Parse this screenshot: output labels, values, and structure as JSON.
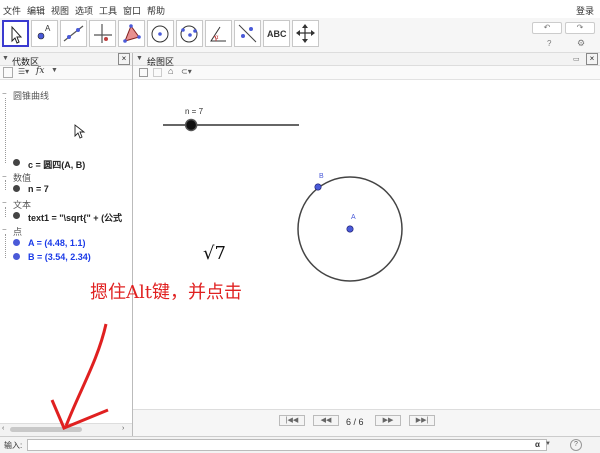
{
  "menu": {
    "items": [
      "文件",
      "编辑",
      "视图",
      "选项",
      "工具",
      "窗口",
      "帮助"
    ],
    "login": "登录"
  },
  "toolbar": {
    "text_tool_label": "ABC",
    "undo_label": "↶",
    "redo_label": "↷",
    "help_label": "?",
    "settings_label": "⚙"
  },
  "algebra": {
    "title": "代数区",
    "groups": [
      {
        "name": "圆锥曲线",
        "items": [
          {
            "text": "c = 圆四(A, B)",
            "color": "#1a1a1a"
          }
        ]
      },
      {
        "name": "数值",
        "items": [
          {
            "text": "n = 7",
            "color": "#1a1a1a"
          }
        ]
      },
      {
        "name": "文本",
        "items": [
          {
            "text": "text1 = \"\\sqrt{\" + (公式",
            "color": "#1a1a1a"
          }
        ]
      },
      {
        "name": "点",
        "items": [
          {
            "text": "A = (4.48, 1.1)",
            "color": "#1a3ae8"
          },
          {
            "text": "B = (3.54, 2.34)",
            "color": "#1a3ae8"
          }
        ]
      }
    ],
    "fx_label": "fx"
  },
  "graphics": {
    "title": "绘图区",
    "slider_label": "n = 7",
    "slider_value": 7,
    "slider_min": 1,
    "slider_max": 30,
    "sqrt_text": "√7",
    "point_a_label": "A",
    "point_b_label": "B",
    "annotation": "摁住Alt键，并点击",
    "page_indicator": "6 / 6"
  },
  "input": {
    "label": "输入:",
    "alpha": "α",
    "help": "?"
  },
  "colors": {
    "point": "#4a5ad8",
    "annotation": "#e02020",
    "selection": "#3a3ad0"
  }
}
